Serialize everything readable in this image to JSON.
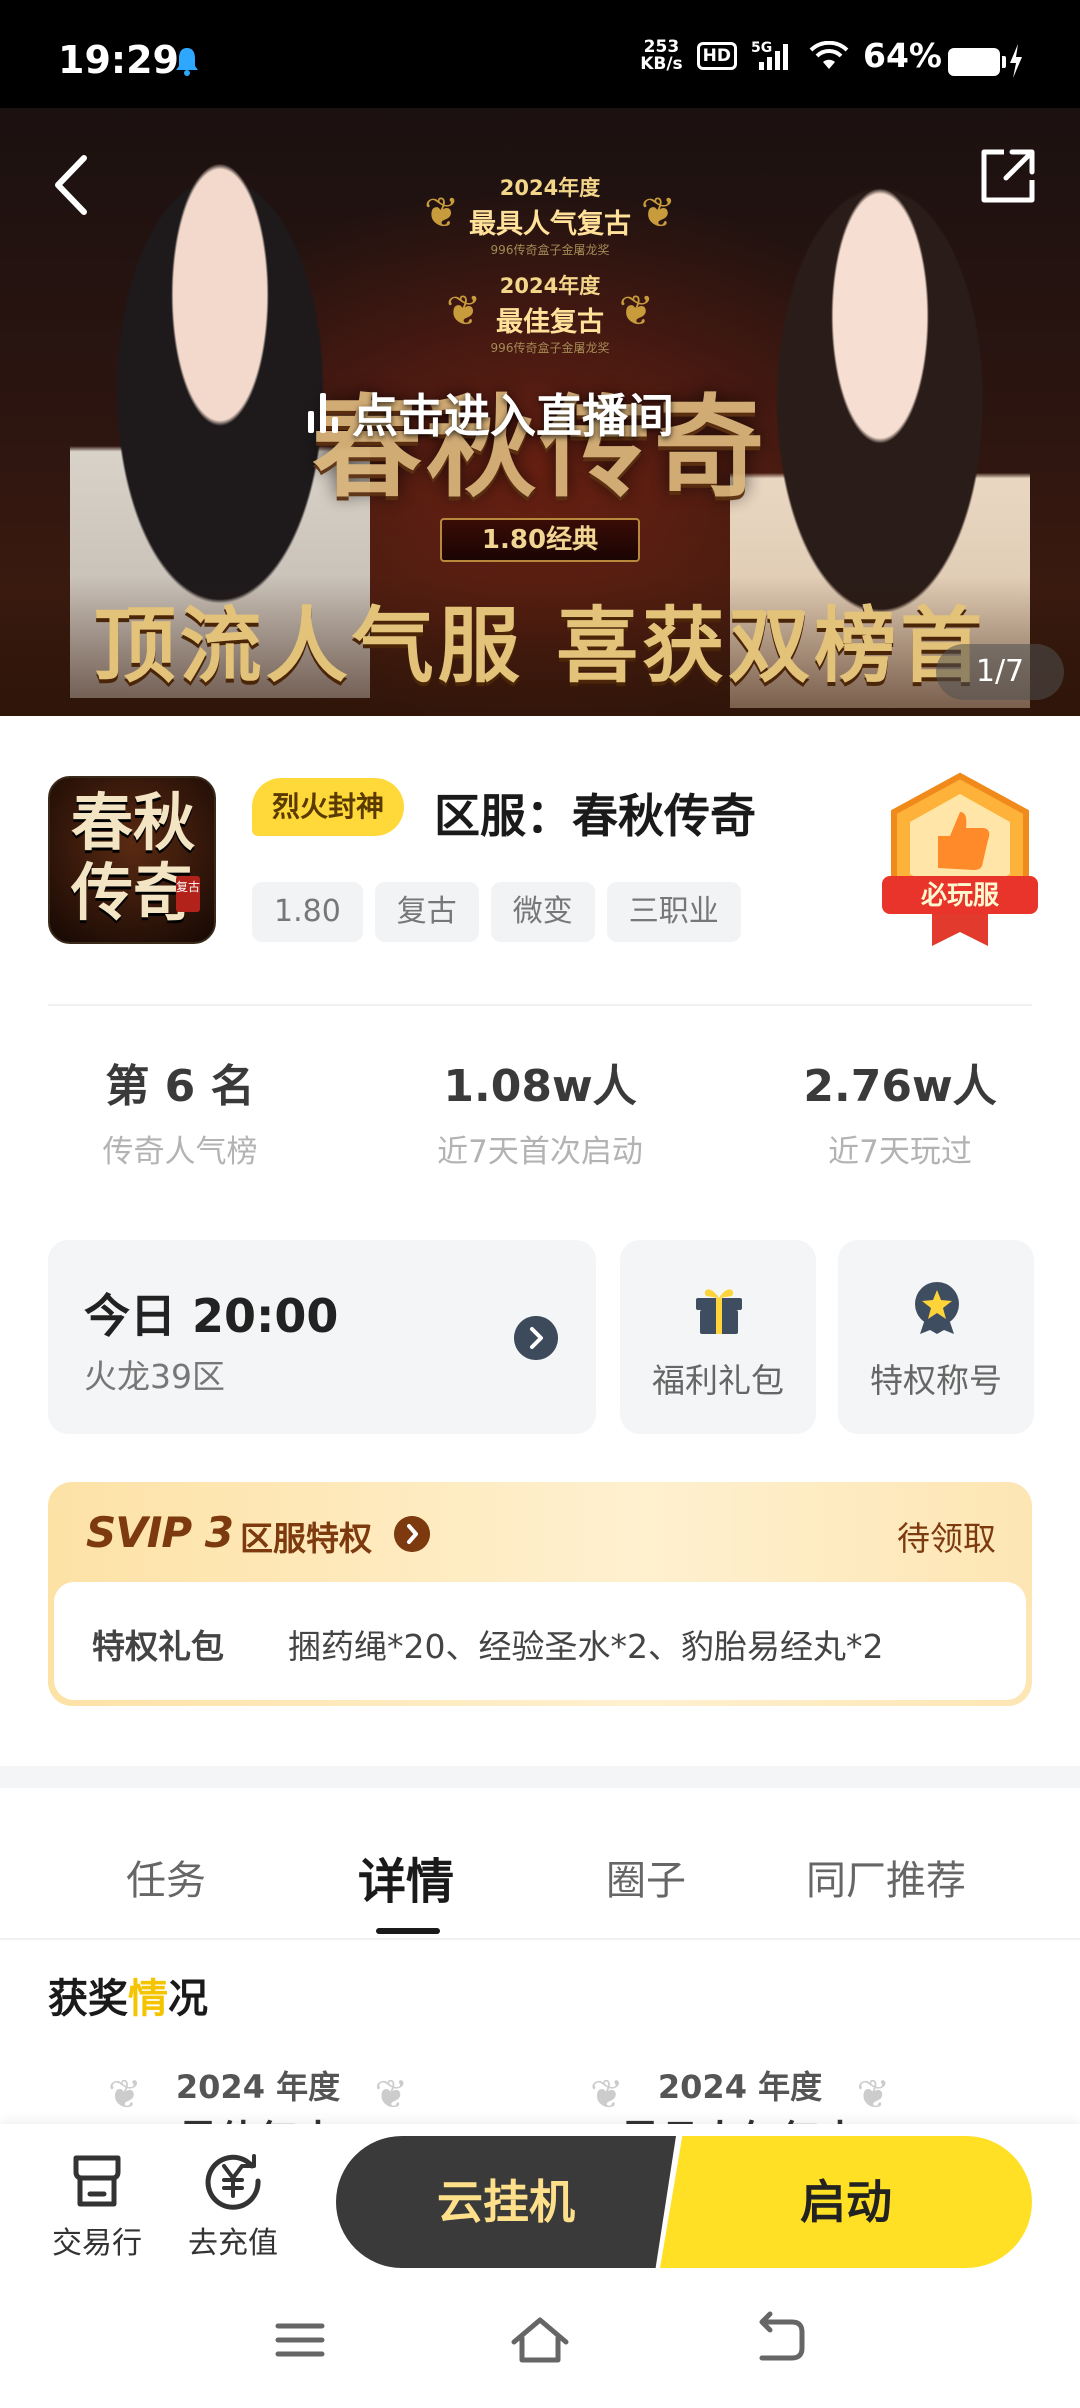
{
  "status_bar": {
    "time": "19:29",
    "net_speed_value": "253",
    "net_speed_unit": "KB/s",
    "hd": "HD",
    "signal": "5G",
    "battery": "64%"
  },
  "banner": {
    "award1_year": "2024年度",
    "award1_name": "最具人气复古",
    "award1_sub": "996传奇盒子金屠龙奖",
    "award2_year": "2024年度",
    "award2_name": "最佳复古",
    "award2_sub": "996传奇盒子金屠龙奖",
    "logo_text": "春秋传奇",
    "version": "1.80经典",
    "live_cta": "点击进入直播间",
    "slogan": "顶流人气服 喜获双榜首",
    "page_indicator": "1/7"
  },
  "game": {
    "icon_text": "春秋传奇",
    "icon_seal": "复古",
    "fire_tag": "烈火封神",
    "title": "区服：春秋传奇",
    "tags": [
      "1.80",
      "复古",
      "微变",
      "三职业"
    ],
    "must_play_badge": "必玩服"
  },
  "stats": [
    {
      "value": "第 6 名",
      "label": "传奇人气榜"
    },
    {
      "value": "1.08w人",
      "label": "近7天首次启动"
    },
    {
      "value": "2.76w人",
      "label": "近7天玩过"
    }
  ],
  "cards": {
    "server_time": "今日 20:00",
    "server_zone": "火龙39区",
    "gift_label": "福利礼包",
    "title_label": "特权称号"
  },
  "svip": {
    "logo": "SVIP 3",
    "title": "区服特权",
    "status": "待领取",
    "gift_key": "特权礼包",
    "gift_value": "捆药绳*20、经验圣水*2、豹胎易经丸*2"
  },
  "tabs": [
    {
      "label": "任务"
    },
    {
      "label": "详情"
    },
    {
      "label": "圈子"
    },
    {
      "label": "同厂推荐"
    }
  ],
  "awards_section": {
    "title_prefix": "获奖",
    "title_mark": "情",
    "title_suffix": "况",
    "items": [
      {
        "year": "2024 年度",
        "name": "最佳复古"
      },
      {
        "year": "2024 年度",
        "name": "最具人气复古"
      }
    ]
  },
  "bottom_bar": {
    "market": "交易行",
    "recharge": "去充值",
    "cloud": "云挂机",
    "launch": "启动"
  },
  "colors": {
    "accent_yellow": "#ffe024",
    "dark_button": "#3a3a3a",
    "svip_brown": "#7c3a0e"
  }
}
